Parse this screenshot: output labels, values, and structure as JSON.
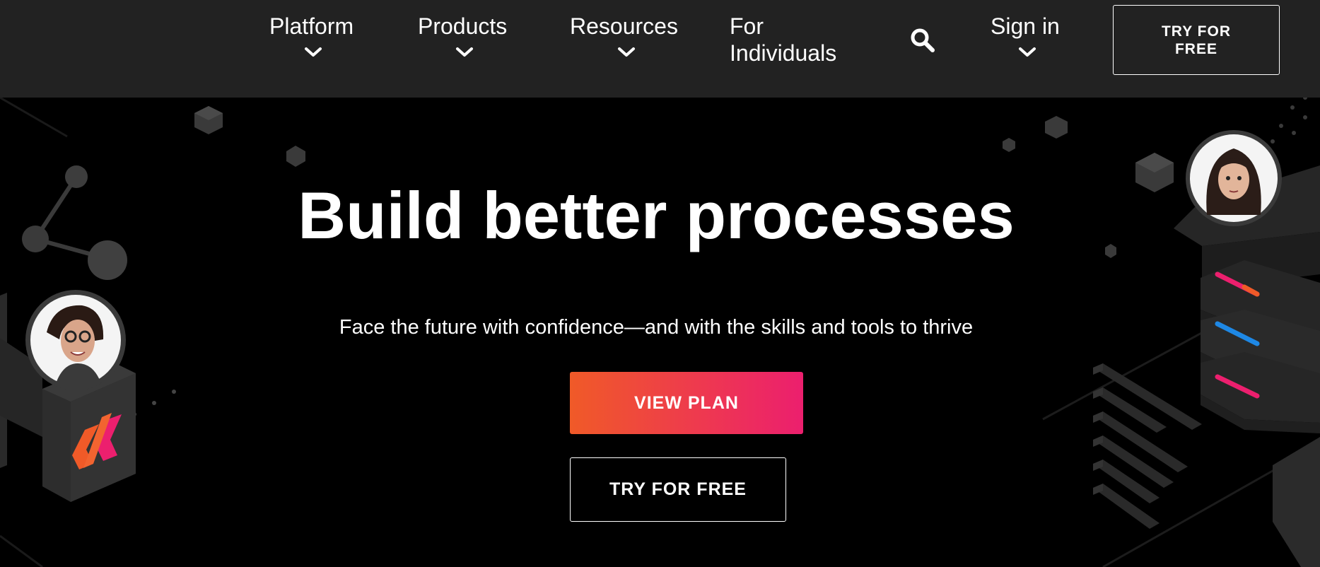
{
  "nav": {
    "items": [
      {
        "label": "Platform"
      },
      {
        "label": "Products"
      },
      {
        "label": "Resources"
      },
      {
        "label": "For Individuals"
      },
      {
        "label": "Sign in"
      }
    ],
    "search_icon": "search-icon",
    "try_free_label": "TRY FOR FREE"
  },
  "hero": {
    "title": "Build better processes",
    "subtitle": "Face the future with confidence—and with the skills and tools to thrive",
    "view_plan_label": "VIEW PLAN",
    "try_free_label": "TRY FOR FREE"
  },
  "colors": {
    "nav_bg": "#222222",
    "page_bg": "#000000",
    "accent_start": "#f05a28",
    "accent_end": "#ec1f6e",
    "accent_blue": "#1e88e5"
  }
}
